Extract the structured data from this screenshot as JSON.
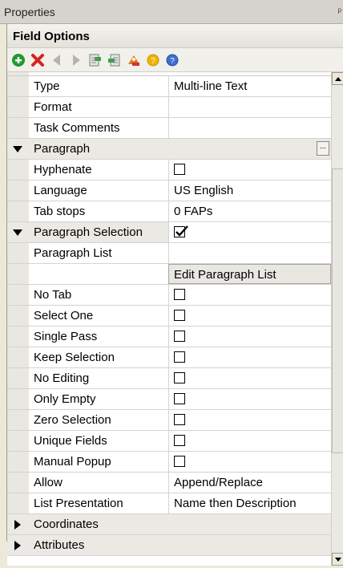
{
  "window": {
    "title": "Properties",
    "pin_glyph": "ᵖ"
  },
  "panel": {
    "header": "Field Options"
  },
  "toolbar": {
    "icons": [
      "add-icon",
      "delete-icon",
      "move-left-icon",
      "move-right-icon",
      "import-icon",
      "export-icon",
      "tools-icon",
      "help-icon",
      "info-icon"
    ]
  },
  "grid": {
    "rows": [
      {
        "name": "Type",
        "value": "Multi-line Text"
      },
      {
        "name": "Format",
        "value": ""
      },
      {
        "name": "Task Comments",
        "value": ""
      },
      {
        "name": "Paragraph",
        "value": ""
      },
      {
        "name": "Hyphenate",
        "value": ""
      },
      {
        "name": "Language",
        "value": "US English"
      },
      {
        "name": "Tab stops",
        "value": "0 FAPs"
      },
      {
        "name": "Paragraph Selection",
        "value": ""
      },
      {
        "name": "Paragraph List",
        "value": ""
      },
      {
        "name": "",
        "value": "Edit Paragraph List"
      },
      {
        "name": "No Tab",
        "value": ""
      },
      {
        "name": "Select One",
        "value": ""
      },
      {
        "name": "Single Pass",
        "value": ""
      },
      {
        "name": "Keep Selection",
        "value": ""
      },
      {
        "name": "No Editing",
        "value": ""
      },
      {
        "name": "Only Empty",
        "value": ""
      },
      {
        "name": "Zero Selection",
        "value": ""
      },
      {
        "name": "Unique Fields",
        "value": ""
      },
      {
        "name": "Manual Popup",
        "value": ""
      },
      {
        "name": "Allow",
        "value": "Append/Replace"
      },
      {
        "name": "List Presentation",
        "value": "Name then Description"
      },
      {
        "name": "Coordinates",
        "value": ""
      },
      {
        "name": "Attributes",
        "value": ""
      }
    ],
    "checkbox_states": {
      "hyphenate": false,
      "paragraph_selection": true,
      "no_tab": false,
      "select_one": false,
      "single_pass": false,
      "keep_selection": false,
      "no_editing": false,
      "only_empty": false,
      "zero_selection": false,
      "unique_fields": false,
      "manual_popup": false
    },
    "ellipsis": "..."
  }
}
